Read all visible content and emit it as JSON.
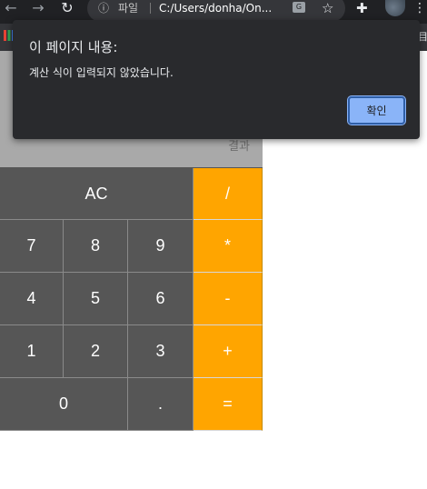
{
  "browser": {
    "back_icon": "back-arrow-icon",
    "forward_icon": "forward-arrow-icon",
    "reload_icon": "reload-icon",
    "info_symbol": "ⓘ",
    "page_label": "파일",
    "url": "C:/Users/donha/On...",
    "bookmark_right": "目"
  },
  "alert": {
    "title": "이 페이지 내용:",
    "message": "계산 식이 입력되지 않았습니다.",
    "ok_label": "확인"
  },
  "calculator": {
    "result_label": "결과",
    "keys": {
      "clear": "AC",
      "divide": "/",
      "seven": "7",
      "eight": "8",
      "nine": "9",
      "multiply": "*",
      "four": "4",
      "five": "5",
      "six": "6",
      "minus": "-",
      "one": "1",
      "two": "2",
      "three": "3",
      "plus": "+",
      "zero": "0",
      "dot": ".",
      "equals": "="
    }
  },
  "colors": {
    "operator": "#ffa500",
    "key": "#565656",
    "display": "#a9a9a9",
    "dialog": "#292a2d",
    "ok_button": "#8ab4f8"
  }
}
